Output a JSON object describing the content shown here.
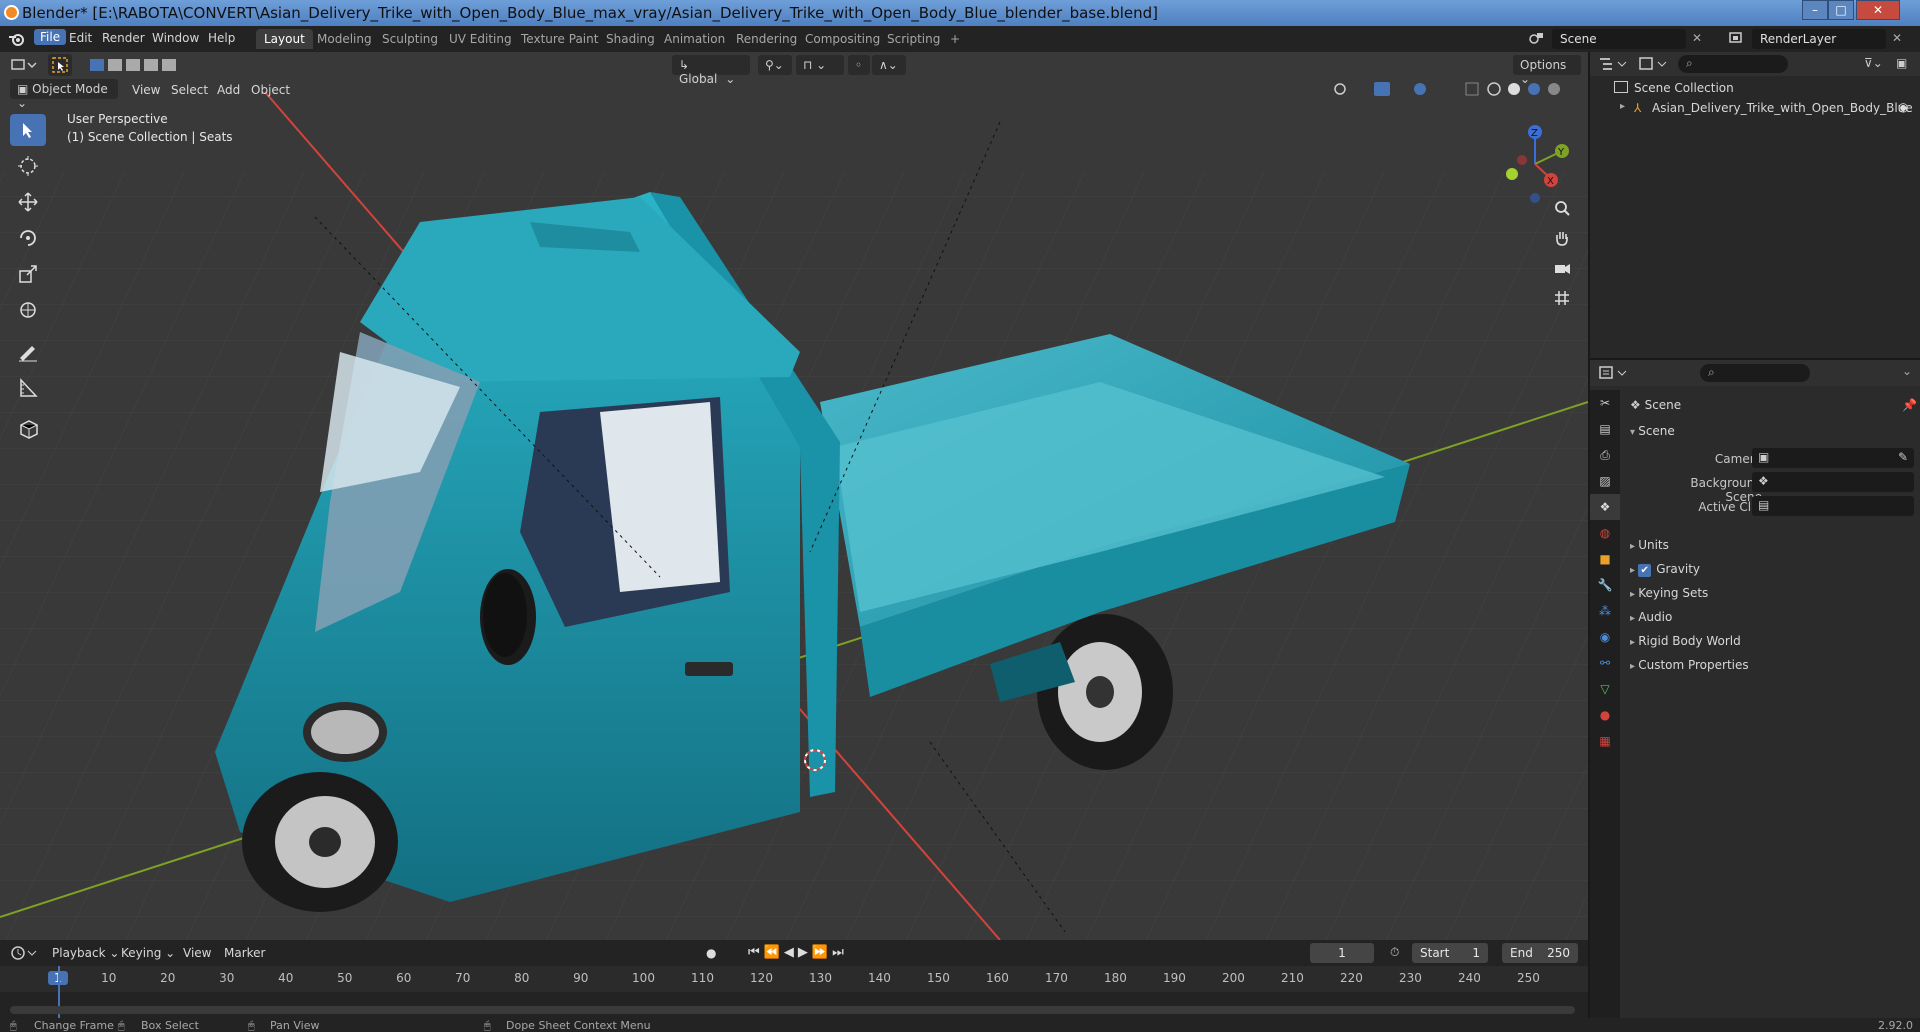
{
  "window": {
    "title": "Blender* [E:\\RABOTA\\CONVERT\\Asian_Delivery_Trike_with_Open_Body_Blue_max_vray/Asian_Delivery_Trike_with_Open_Body_Blue_blender_base.blend]",
    "controls": {
      "minimize": "–",
      "maximize": "□",
      "close": "✕"
    }
  },
  "menu": {
    "items": [
      "File",
      "Edit",
      "Render",
      "Window",
      "Help"
    ],
    "active": "File"
  },
  "workspaces": {
    "tabs": [
      "Layout",
      "Modeling",
      "Sculpting",
      "UV Editing",
      "Texture Paint",
      "Shading",
      "Animation",
      "Rendering",
      "Compositing",
      "Scripting"
    ],
    "active": "Layout",
    "add_label": "+"
  },
  "scene_selector": {
    "value": "Scene"
  },
  "view_layer_selector": {
    "value": "RenderLayer"
  },
  "viewport": {
    "mode": "Object Mode",
    "menus": [
      "View",
      "Select",
      "Add",
      "Object"
    ],
    "orientation": "Global",
    "options_label": "Options",
    "overlay_line1": "User Perspective",
    "overlay_line2": "(1) Scene Collection | Seats",
    "gizmo_axes": {
      "x": "X",
      "y": "Y",
      "z": "Z"
    },
    "colors": {
      "background": "#393939",
      "x_axis": "#d2443b",
      "y_axis": "#7ea224",
      "grid": "#454545",
      "vehicle": "#1f97ad"
    }
  },
  "outliner": {
    "header_icon": "outliner-icon",
    "search_placeholder": "",
    "root": "Scene Collection",
    "items": [
      {
        "label": "Asian_Delivery_Trike_with_Open_Body_Blue",
        "visible": true
      }
    ]
  },
  "properties": {
    "context_title": "Scene",
    "panel_title": "Scene",
    "fields": [
      {
        "label": "Camera",
        "value": ""
      },
      {
        "label": "Background Scene",
        "value": ""
      },
      {
        "label": "Active Clip",
        "value": ""
      }
    ],
    "sections": [
      {
        "label": "Units",
        "checkbox": false
      },
      {
        "label": "Gravity",
        "checkbox": true
      },
      {
        "label": "Keying Sets",
        "checkbox": false
      },
      {
        "label": "Audio",
        "checkbox": false
      },
      {
        "label": "Rigid Body World",
        "checkbox": false
      },
      {
        "label": "Custom Properties",
        "checkbox": false
      }
    ]
  },
  "timeline": {
    "menus": [
      "Playback",
      "Keying",
      "View",
      "Marker"
    ],
    "current_frame": "1",
    "start_label": "Start",
    "start_value": "1",
    "end_label": "End",
    "end_value": "250",
    "ruler": [
      "1",
      "10",
      "20",
      "30",
      "40",
      "50",
      "60",
      "70",
      "80",
      "90",
      "100",
      "110",
      "120",
      "130",
      "140",
      "150",
      "160",
      "170",
      "180",
      "190",
      "200",
      "210",
      "220",
      "230",
      "240",
      "250"
    ]
  },
  "statusbar": {
    "items": [
      "Change Frame",
      "Box Select",
      "Pan View",
      "Dope Sheet Context Menu"
    ],
    "version": "2.92.0"
  }
}
